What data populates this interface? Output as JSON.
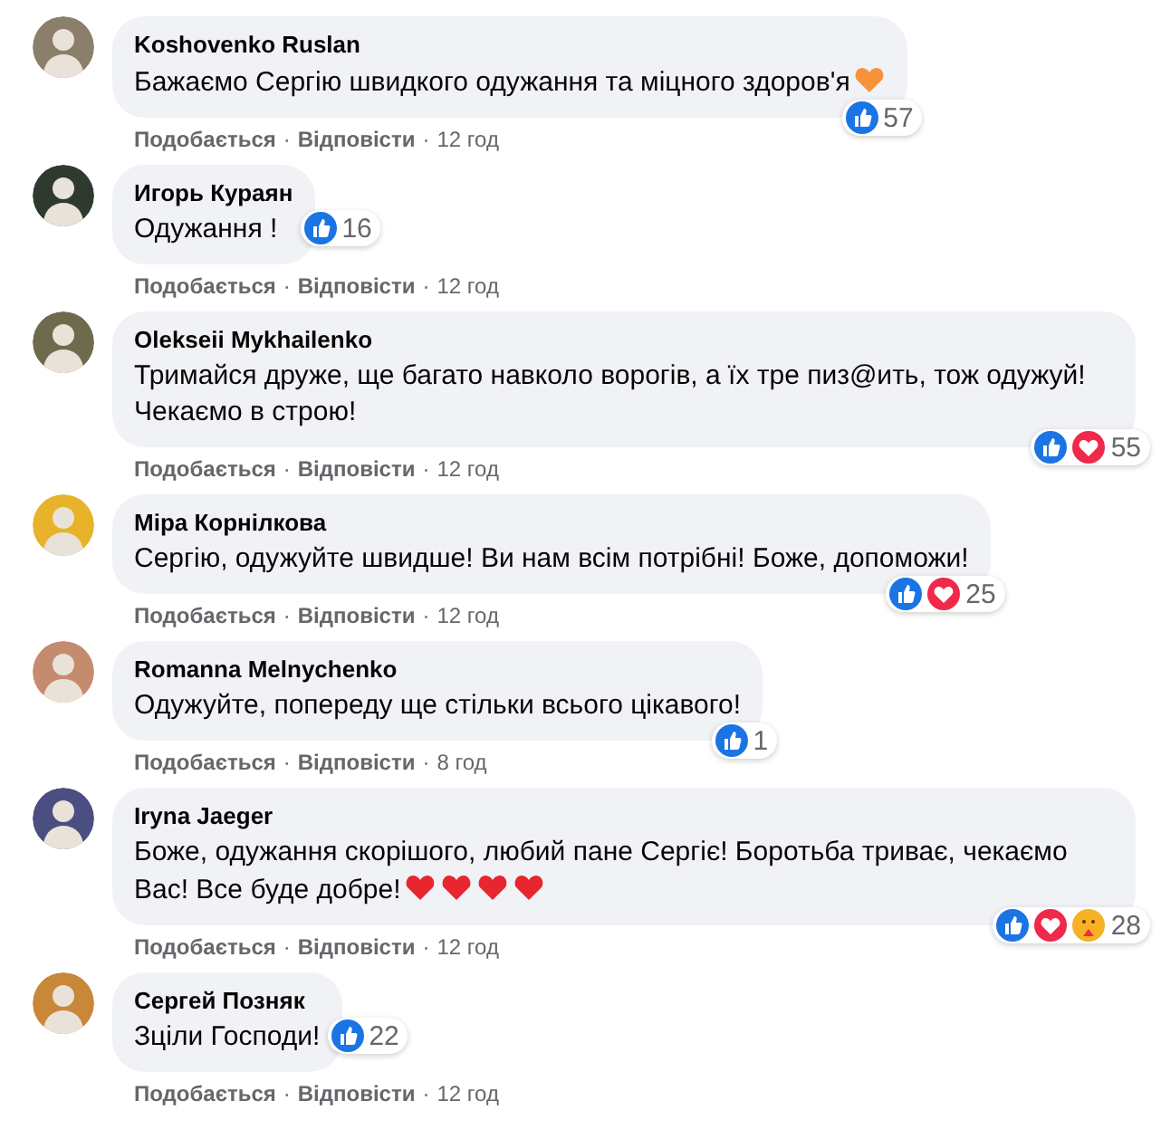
{
  "comments": [
    {
      "author": "Koshovenko Ruslan",
      "text": "Бажаємо Сергію швидкого одужання та міцного здоров'я",
      "emoji": [
        {
          "color": "#f7923b"
        }
      ],
      "reactions": [
        {
          "kind": "like"
        }
      ],
      "count": "57",
      "reactions_beside": false,
      "actions": [
        "Подобається",
        "·",
        "Відповісти",
        "·"
      ],
      "time": "12 год"
    },
    {
      "author": "Игорь Кураян",
      "text": "Одужання !",
      "reactions": [
        {
          "kind": "like"
        }
      ],
      "count": "16",
      "reactions_beside": true,
      "actions": [
        "Подобається",
        "·",
        "Відповісти",
        "·"
      ],
      "time": "12 год"
    },
    {
      "author": "Oleksеii Mykhailenko",
      "text": "Тримайся друже, ще багато навколо ворогів, а їх тре пиз@ить, тож одужуй! Чекаємо в строю!",
      "reactions": [
        {
          "kind": "like"
        },
        {
          "kind": "love"
        }
      ],
      "count": "55",
      "reactions_beside": false,
      "actions": [
        "Подобається",
        "·",
        "Відповісти",
        "·"
      ],
      "time": "12 год"
    },
    {
      "author": "Міра Корнілкова",
      "text": "Сергію, одужуйте швидше! Ви нам всім потрібні! Боже, допоможи!",
      "reactions": [
        {
          "kind": "like"
        },
        {
          "kind": "love"
        }
      ],
      "count": "25",
      "reactions_beside": false,
      "actions": [
        "Подобається",
        "·",
        "Відповісти",
        "·"
      ],
      "time": "12 год"
    },
    {
      "author": "Romanna Melnychenko",
      "text": "Одужуйте, попереду ще стільки всього цікавого!",
      "reactions": [
        {
          "kind": "like"
        }
      ],
      "count": "1",
      "reactions_beside": false,
      "actions": [
        "Подобається",
        "·",
        "Відповісти",
        "·"
      ],
      "time": "8 год"
    },
    {
      "author": "Iryna Jaeger",
      "text": "Боже, одужання скорішого, любий пане Сергіє! Боротьба триває, чекаємо Вас! Все буде добре!",
      "emoji": [
        {
          "color": "#e8262f"
        },
        {
          "color": "#e8262f"
        },
        {
          "color": "#e8262f"
        },
        {
          "color": "#e8262f"
        }
      ],
      "reactions": [
        {
          "kind": "like"
        },
        {
          "kind": "love"
        },
        {
          "kind": "care"
        }
      ],
      "count": "28",
      "reactions_beside": false,
      "actions": [
        "Подобається",
        "·",
        "Відповісти",
        "·"
      ],
      "time": "12 год"
    },
    {
      "author": "Сергей Позняк",
      "text": "Зцiли Господи!",
      "reactions": [
        {
          "kind": "like"
        }
      ],
      "count": "22",
      "reactions_beside": true,
      "actions": [
        "Подобається",
        "·",
        "Відповісти",
        "·"
      ],
      "time": "12 год"
    }
  ]
}
